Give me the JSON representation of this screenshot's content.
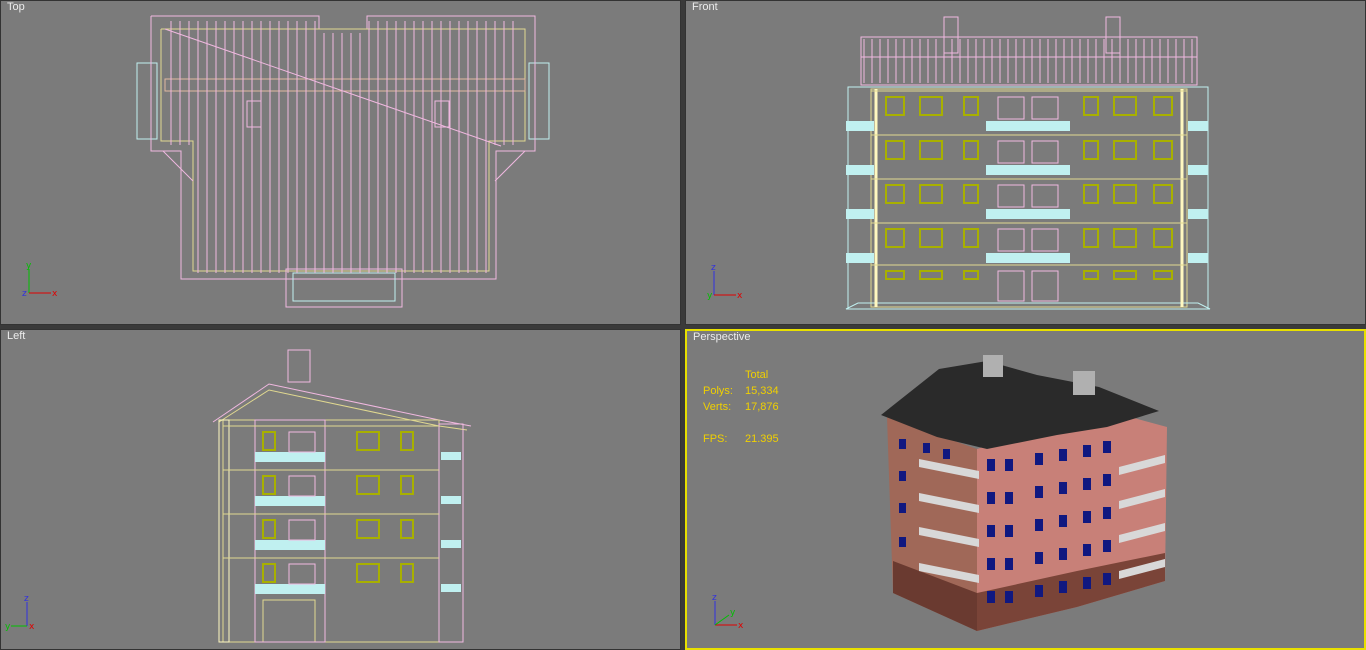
{
  "viewports": {
    "top": {
      "label": "Top",
      "axis": {
        "v": "y",
        "h": "x",
        "o": "z"
      }
    },
    "front": {
      "label": "Front",
      "axis": {
        "v": "z",
        "h": "x",
        "o": "y"
      }
    },
    "left": {
      "label": "Left",
      "axis": {
        "v": "z",
        "h": "y",
        "o": "x"
      }
    },
    "perspective": {
      "label": "Perspective",
      "axis": {
        "v": "z",
        "h": "x",
        "o": "y"
      }
    }
  },
  "stats": {
    "header": "Total",
    "polys_label": "Polys:",
    "polys_value": "15,334",
    "verts_label": "Verts:",
    "verts_value": "17,876",
    "fps_label": "FPS:",
    "fps_value": "21.395"
  },
  "colors": {
    "viewport_bg": "#7b7b7b",
    "active_border": "#e8e000",
    "wire_pink": "#f0b8e0",
    "wire_yellow": "#e0d890",
    "wire_cyan": "#c0f0f0",
    "wire_olive": "#a8b000"
  }
}
